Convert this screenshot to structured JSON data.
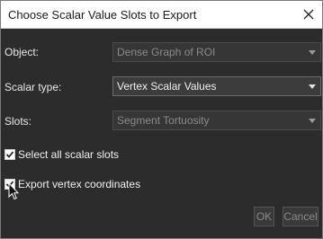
{
  "window": {
    "title": "Choose Scalar Value Slots to Export"
  },
  "form": {
    "object": {
      "label": "Object:",
      "value": "Dense Graph of  ROI"
    },
    "scalar_type": {
      "label": "Scalar type:",
      "value": "Vertex Scalar Values"
    },
    "slots": {
      "label": "Slots:",
      "value": "Segment Tortuosity"
    }
  },
  "checkboxes": {
    "select_all": {
      "label": "Select all scalar slots",
      "checked": true
    },
    "export_coords": {
      "label": "Export vertex coordinates",
      "checked": true
    }
  },
  "buttons": {
    "ok": "OK",
    "cancel": "Cancel"
  }
}
